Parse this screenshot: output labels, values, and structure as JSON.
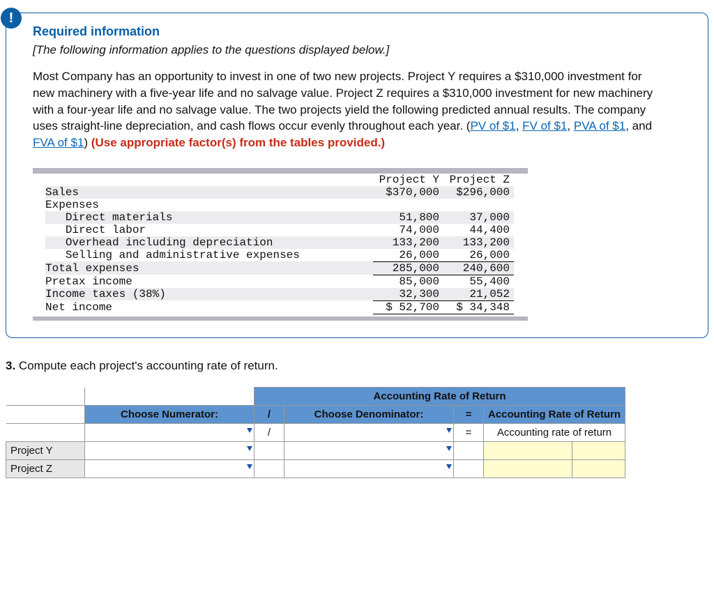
{
  "badge": "!",
  "req_title": "Required information",
  "italic_note": "[The following information applies to the questions displayed below.]",
  "para_before_links": "Most Company has an opportunity to invest in one of two new projects. Project Y requires a $310,000 investment for new machinery with a five-year life and no salvage value. Project Z requires a $310,000 investment for new machinery with a four-year life and no salvage value. The two projects yield the following predicted annual results. The company uses straight-line depreciation, and cash flows occur evenly throughout each year. (",
  "links": {
    "pv": "PV of $1",
    "fv": "FV of $1",
    "pva": "PVA of $1",
    "fva": "FVA of $1"
  },
  "sep_comma": ", ",
  "sep_and": ", and ",
  "close_paren": ") ",
  "red_instruction": "(Use appropriate factor(s) from the tables provided.)",
  "fin": {
    "header": {
      "label": "",
      "y": "Project Y",
      "z": "Project Z"
    },
    "rows": [
      {
        "label": "Sales",
        "y": "$370,000",
        "z": "$296,000",
        "indent": 0
      },
      {
        "label": "Expenses",
        "y": "",
        "z": "",
        "indent": 0
      },
      {
        "label": "Direct materials",
        "y": "51,800",
        "z": "37,000",
        "indent": 1
      },
      {
        "label": "Direct labor",
        "y": "74,000",
        "z": "44,400",
        "indent": 1
      },
      {
        "label": "Overhead including depreciation",
        "y": "133,200",
        "z": "133,200",
        "indent": 1
      },
      {
        "label": "Selling and administrative expenses",
        "y": "26,000",
        "z": "26,000",
        "indent": 1
      },
      {
        "label": "Total expenses",
        "y": "285,000",
        "z": "240,600",
        "indent": 0
      },
      {
        "label": "Pretax income",
        "y": "85,000",
        "z": "55,400",
        "indent": 0
      },
      {
        "label": "Income taxes (38%)",
        "y": "32,300",
        "z": "21,052",
        "indent": 0
      },
      {
        "label": "Net income",
        "y": "$ 52,700",
        "z": "$ 34,348",
        "indent": 0
      }
    ]
  },
  "question": {
    "num": "3.",
    "text": " Compute each project's accounting rate of return."
  },
  "answer_table": {
    "title": "Accounting Rate of Return",
    "numerator_header": "Choose Numerator:",
    "slash": "/",
    "denominator_header": "Choose Denominator:",
    "equals": "=",
    "result_header": "Accounting Rate of Return",
    "result_row_label": "Accounting rate of return",
    "projects": [
      "Project Y",
      "Project Z"
    ]
  }
}
